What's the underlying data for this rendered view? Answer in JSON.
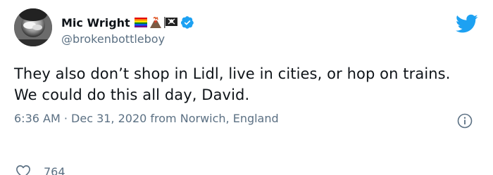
{
  "author": {
    "display_name": "Mic Wright",
    "handle": "@brokenbottleboy",
    "emoji_icons": [
      "rainbow-flag-icon",
      "volcano-icon",
      "pirate-flag-icon"
    ],
    "verified": true
  },
  "tweet": {
    "text": "They also don’t shop in Lidl, live in cities, or hop on trains. We could do this all day, David.",
    "meta": "6:36 AM · Dec 31, 2020 from Norwich, England"
  },
  "engagement": {
    "likes": "764"
  },
  "colors": {
    "twitter_blue": "#1da1f2",
    "secondary_text": "#5b7083",
    "primary_text": "#0f1419"
  }
}
